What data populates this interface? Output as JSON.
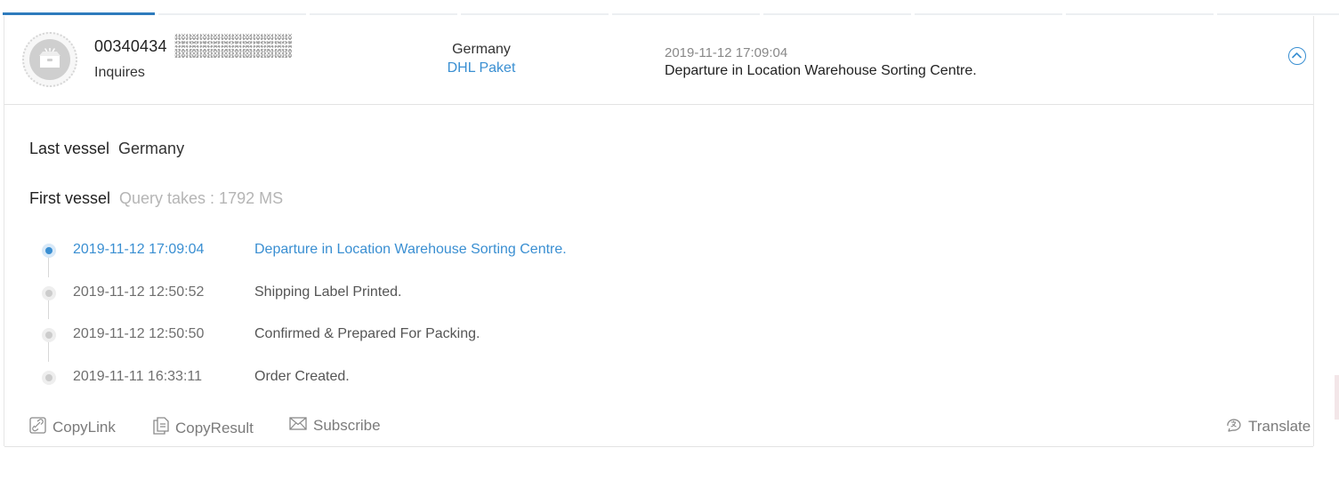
{
  "tabs": {
    "count": 9,
    "active_index": 0
  },
  "summary": {
    "tracking_number": "00340434",
    "status": "Inquires",
    "destination_country": "Germany",
    "carrier": "DHL Paket",
    "latest_time": "2019-11-12 17:09:04",
    "latest_event": "Departure in Location Warehouse Sorting Centre."
  },
  "details": {
    "last_vessel_label": "Last vessel",
    "last_vessel_value": "Germany",
    "first_vessel_label": "First vessel",
    "first_vessel_value": "Query takes : 1792 MS"
  },
  "events": [
    {
      "time": "2019-11-12 17:09:04",
      "description": "Departure in Location Warehouse Sorting Centre.",
      "current": true
    },
    {
      "time": "2019-11-12 12:50:52",
      "description": "Shipping Label Printed.",
      "current": false
    },
    {
      "time": "2019-11-12 12:50:50",
      "description": "Confirmed & Prepared For Packing.",
      "current": false
    },
    {
      "time": "2019-11-11 16:33:11",
      "description": "Order Created.",
      "current": false
    }
  ],
  "actions": {
    "copy_link": "CopyLink",
    "copy_result": "CopyResult",
    "subscribe": "Subscribe",
    "translate": "Translate"
  },
  "icons": {
    "avatar": "parcel-box-icon",
    "collapse": "chevron-up-circle-icon",
    "copy_link": "link-icon",
    "copy_result": "document-icon",
    "subscribe": "envelope-icon",
    "translate": "translate-icon"
  },
  "colors": {
    "accent": "#3a8fd2",
    "tab_active": "#2e7bbd",
    "muted": "#b5b5b5"
  }
}
